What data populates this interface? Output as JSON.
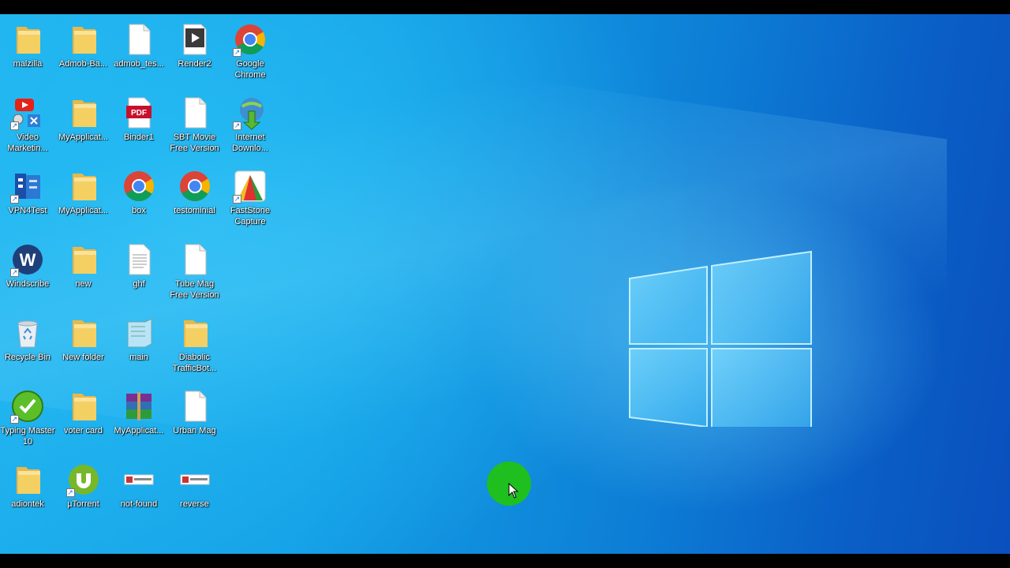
{
  "desktop": {
    "icons": [
      {
        "label": "malzilla",
        "icon": "folder-icon",
        "col": 0,
        "row": 0
      },
      {
        "label": "Admob-Ba...",
        "icon": "folder-icon",
        "col": 1,
        "row": 0
      },
      {
        "label": "admob_tes...",
        "icon": "blank-file-icon",
        "col": 2,
        "row": 0
      },
      {
        "label": "Render2",
        "icon": "video-file-icon",
        "col": 3,
        "row": 0
      },
      {
        "label": "Google Chrome",
        "icon": "chrome-icon",
        "col": 4,
        "row": 0,
        "shortcut": true
      },
      {
        "label": "Video Marketin...",
        "icon": "video-marketing-icon",
        "col": 0,
        "row": 1,
        "shortcut": true
      },
      {
        "label": "MyApplicat...",
        "icon": "folder-icon",
        "col": 1,
        "row": 1
      },
      {
        "label": "Binder1",
        "icon": "pdf-icon",
        "col": 2,
        "row": 1
      },
      {
        "label": "SBT Movie Free Version",
        "icon": "blank-file-icon",
        "col": 3,
        "row": 1
      },
      {
        "label": "Internet Downlo...",
        "icon": "internet-download-manager-icon",
        "col": 4,
        "row": 1,
        "shortcut": true
      },
      {
        "label": "VPN4Test",
        "icon": "vpn-icon",
        "col": 0,
        "row": 2,
        "shortcut": true
      },
      {
        "label": "MyApplicat...",
        "icon": "folder-icon",
        "col": 1,
        "row": 2
      },
      {
        "label": "box",
        "icon": "chrome-icon",
        "col": 2,
        "row": 2
      },
      {
        "label": "testominial",
        "icon": "chrome-icon",
        "col": 3,
        "row": 2
      },
      {
        "label": "FastStone Capture",
        "icon": "faststone-icon",
        "col": 4,
        "row": 2,
        "shortcut": true
      },
      {
        "label": "Windscribe",
        "icon": "windscribe-icon",
        "col": 0,
        "row": 3,
        "shortcut": true
      },
      {
        "label": "new",
        "icon": "folder-icon",
        "col": 1,
        "row": 3
      },
      {
        "label": "ghf",
        "icon": "text-file-icon",
        "col": 2,
        "row": 3
      },
      {
        "label": "Tube Mag Free Version",
        "icon": "blank-file-icon",
        "col": 3,
        "row": 3
      },
      {
        "label": "Recycle Bin",
        "icon": "recycle-bin-icon",
        "col": 0,
        "row": 4
      },
      {
        "label": "New folder",
        "icon": "folder-icon",
        "col": 1,
        "row": 4
      },
      {
        "label": "main",
        "icon": "notepad-icon",
        "col": 2,
        "row": 4
      },
      {
        "label": "Diabolic TrafficBot...",
        "icon": "folder-icon",
        "col": 3,
        "row": 4
      },
      {
        "label": "Typing Master 10",
        "icon": "typing-master-icon",
        "col": 0,
        "row": 5,
        "shortcut": true
      },
      {
        "label": "voter card",
        "icon": "folder-icon",
        "col": 1,
        "row": 5
      },
      {
        "label": "MyApplicat...",
        "icon": "winrar-icon",
        "col": 2,
        "row": 5
      },
      {
        "label": "Urban Mag",
        "icon": "blank-file-icon",
        "col": 3,
        "row": 5
      },
      {
        "label": "adiontek",
        "icon": "folder-icon",
        "col": 0,
        "row": 6
      },
      {
        "label": "µTorrent",
        "icon": "utorrent-icon",
        "col": 1,
        "row": 6,
        "shortcut": true
      },
      {
        "label": "not-found",
        "icon": "image-file-icon",
        "col": 2,
        "row": 6
      },
      {
        "label": "reverse",
        "icon": "image-file-icon",
        "col": 3,
        "row": 6
      }
    ]
  },
  "colors": {
    "folder": "#f4cf62",
    "chrome_red": "#db4437",
    "chrome_yellow": "#f4b400",
    "chrome_green": "#0f9d58",
    "chrome_blue": "#4285f4",
    "cursor_halo": "#1fbf1f"
  }
}
